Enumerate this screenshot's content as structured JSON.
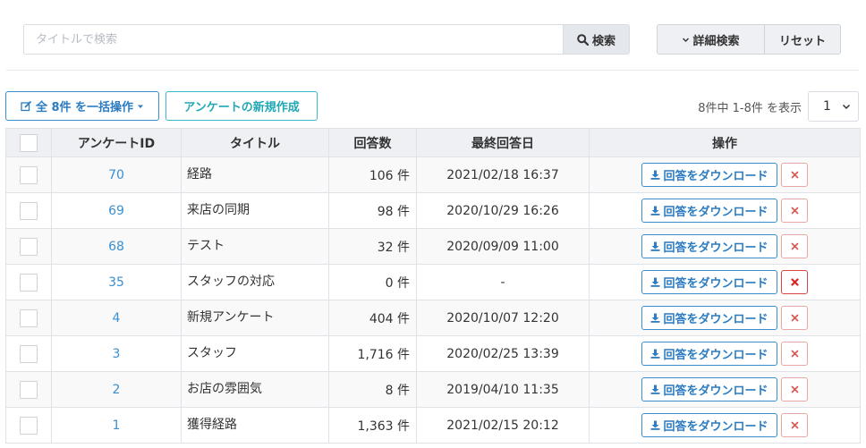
{
  "search": {
    "placeholder": "タイトルで検索",
    "value": "",
    "search_label": "検索",
    "advanced_label": "詳細検索",
    "reset_label": "リセット"
  },
  "toolbar": {
    "bulk_label": "全 8件 を一括操作",
    "create_label": "アンケートの新規作成",
    "count_text": "8件中 1-8件 を表示",
    "page_selected": "1"
  },
  "table": {
    "columns": [
      "アンケートID",
      "タイトル",
      "回答数",
      "最終回答日",
      "操作"
    ],
    "download_label": "回答をダウンロード",
    "rows": [
      {
        "id": "70",
        "title": "経路",
        "count": "106 件",
        "date": "2021/02/18 16:37"
      },
      {
        "id": "69",
        "title": "来店の同期",
        "count": "98 件",
        "date": "2020/10/29 16:26"
      },
      {
        "id": "68",
        "title": "テスト",
        "count": "32 件",
        "date": "2020/09/09 11:00"
      },
      {
        "id": "35",
        "title": "スタッフの対応",
        "count": "0 件",
        "date": "-"
      },
      {
        "id": "4",
        "title": "新規アンケート",
        "count": "404 件",
        "date": "2020/10/07 12:20"
      },
      {
        "id": "3",
        "title": "スタッフ",
        "count": "1,716 件",
        "date": "2020/02/25 13:39"
      },
      {
        "id": "2",
        "title": "お店の雰囲気",
        "count": "8 件",
        "date": "2019/04/10 11:35"
      },
      {
        "id": "1",
        "title": "獲得経路",
        "count": "1,363 件",
        "date": "2021/02/15 20:12"
      }
    ]
  },
  "colors": {
    "primary": "#2b7cc2",
    "teal": "#22a7b4",
    "danger": "#d9534f",
    "header_bg": "#eef0f3"
  }
}
